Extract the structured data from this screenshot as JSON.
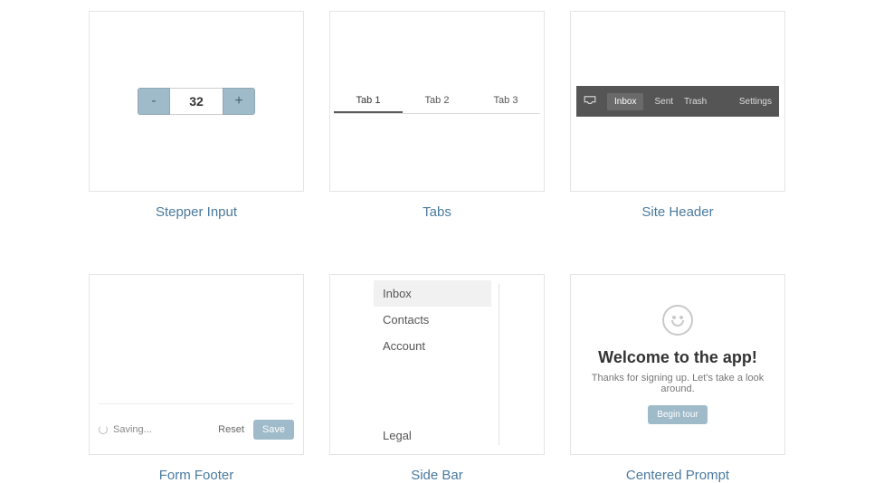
{
  "stepper": {
    "caption": "Stepper Input",
    "minus": "-",
    "plus": "+",
    "value": "32"
  },
  "tabs": {
    "caption": "Tabs",
    "items": [
      "Tab 1",
      "Tab 2",
      "Tab 3"
    ]
  },
  "site_header": {
    "caption": "Site Header",
    "items": [
      "Inbox",
      "Sent",
      "Trash"
    ],
    "settings": "Settings"
  },
  "form_footer": {
    "caption": "Form Footer",
    "status": "Saving...",
    "reset": "Reset",
    "save": "Save"
  },
  "sidebar": {
    "caption": "Side Bar",
    "top": [
      "Inbox",
      "Contacts",
      "Account"
    ],
    "bottom": "Legal"
  },
  "prompt": {
    "caption": "Centered Prompt",
    "title": "Welcome to the app!",
    "subtitle": "Thanks for signing up. Let's take a look around.",
    "button": "Begin tour"
  }
}
